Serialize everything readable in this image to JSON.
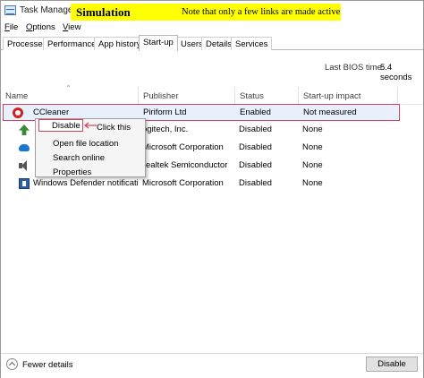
{
  "window": {
    "title": "Task Manager"
  },
  "banner": {
    "title": "Simulation",
    "note": "Note that only a few links are made active",
    "color": "#ffff00"
  },
  "menu": [
    {
      "key": "F",
      "rest": "ile"
    },
    {
      "key": "O",
      "rest": "ptions"
    },
    {
      "key": "V",
      "rest": "iew"
    }
  ],
  "tabs": [
    "Processes",
    "Performance",
    "App history",
    "Start-up",
    "Users",
    "Details",
    "Services"
  ],
  "active_tab": "Start-up",
  "bios": {
    "label": "Last BIOS time:",
    "value": "5.4 seconds"
  },
  "columns": [
    "Name",
    "Publisher",
    "Status",
    "Start-up impact"
  ],
  "rows": [
    {
      "name": "CCleaner",
      "publisher": "Piriform Ltd",
      "status": "Enabled",
      "impact": "Not measured",
      "icon": "ccleaner-icon"
    },
    {
      "name": "",
      "publisher": "ogitech, Inc.",
      "status": "Disabled",
      "impact": "None",
      "icon": "logitech-icon"
    },
    {
      "name": "",
      "publisher": "Microsoft Corporation",
      "status": "Disabled",
      "impact": "None",
      "icon": "onedrive-icon"
    },
    {
      "name": "",
      "publisher": "ealtek Semiconductor",
      "status": "Disabled",
      "impact": "None",
      "icon": "speaker-icon"
    },
    {
      "name": "Windows Defender notificati...",
      "publisher": "Microsoft Corporation",
      "status": "Disabled",
      "impact": "None",
      "icon": "defender-icon"
    }
  ],
  "context_menu": {
    "disable": "Disable",
    "items": [
      "Open file location",
      "Search online",
      "Properties"
    ]
  },
  "annotation": {
    "click_label": "Click this",
    "highlight_color": "#d04060"
  },
  "footer": {
    "fewer_details": "Fewer details",
    "disable_button": "Disable"
  }
}
